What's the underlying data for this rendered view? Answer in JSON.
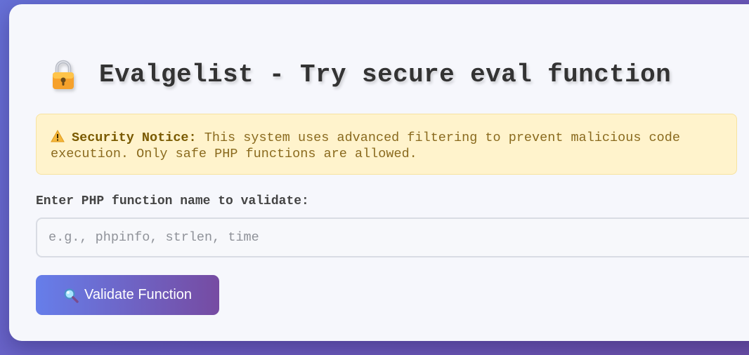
{
  "header": {
    "icon": "lock-icon",
    "title": "Evalgelist - Try secure eval function"
  },
  "notice": {
    "icon": "warning-icon",
    "heading": "Security Notice:",
    "text": " This system uses advanced filtering to prevent malicious code execution. Only safe PHP functions are allowed."
  },
  "form": {
    "label": "Enter PHP function name to validate:",
    "placeholder": "e.g., phpinfo, strlen, time",
    "value": "",
    "button_icon": "search-icon",
    "button_label": "Validate Function"
  },
  "colors": {
    "background_start": "#6670d6",
    "background_end": "#6b4fa8",
    "notice_bg": "#fff3cc",
    "notice_text": "#8a6a1e",
    "button_start": "#667eea",
    "button_end": "#764ba2"
  }
}
